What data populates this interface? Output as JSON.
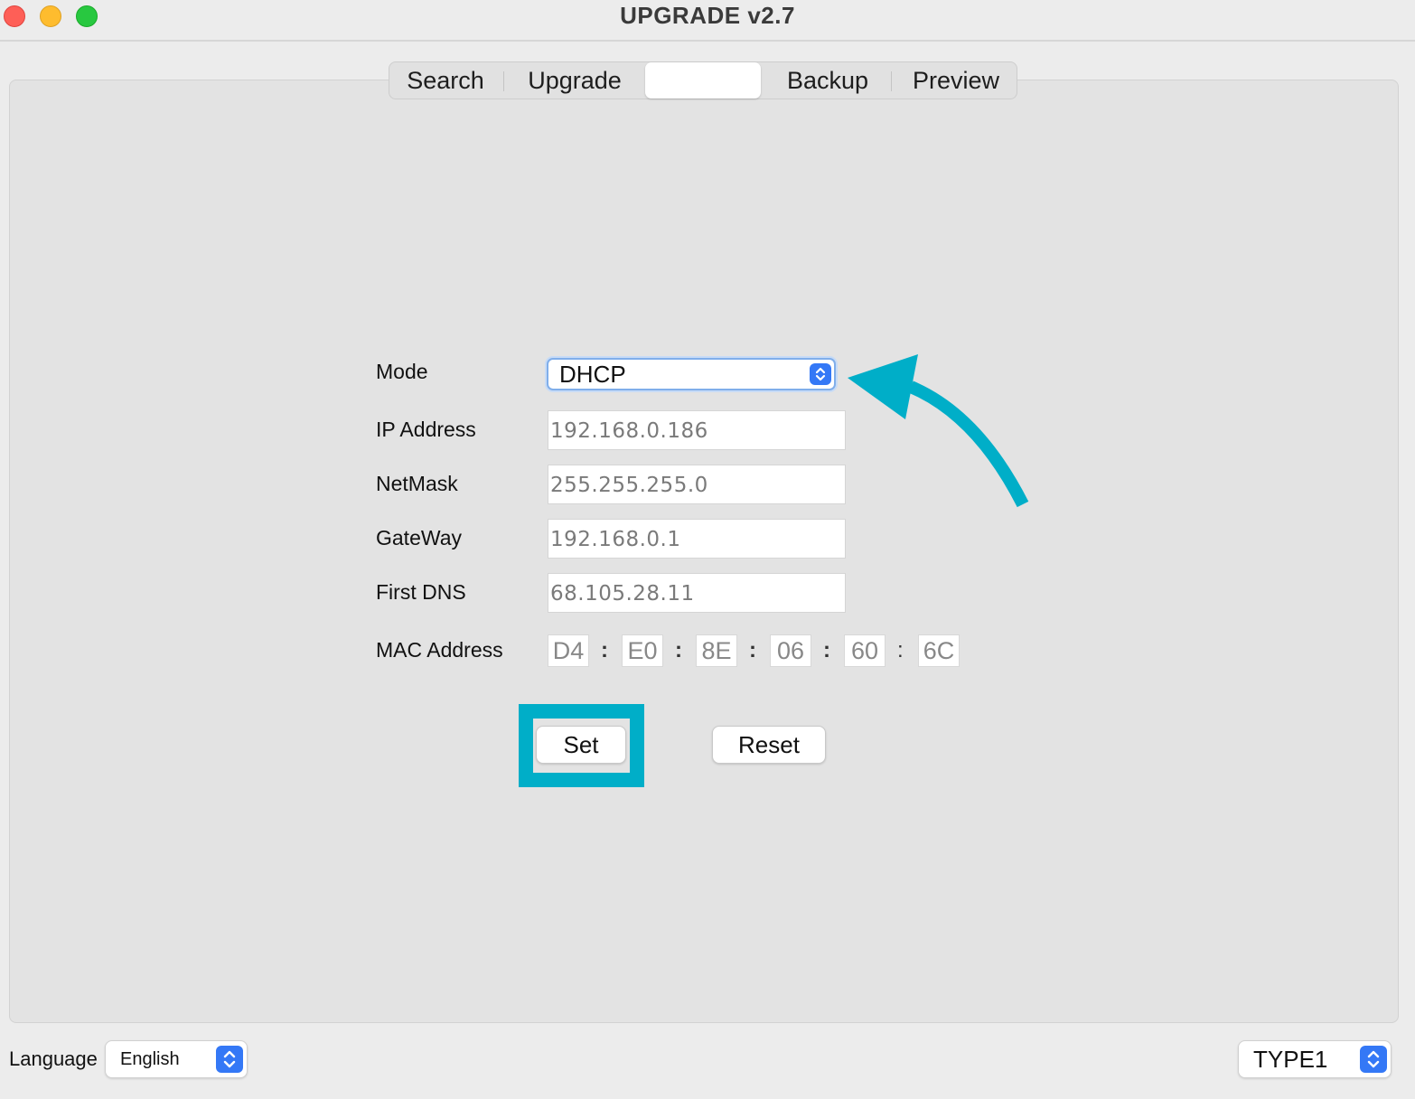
{
  "window": {
    "title": "UPGRADE v2.7"
  },
  "tabs": [
    {
      "label": "Search"
    },
    {
      "label": "Upgrade"
    },
    {
      "label": ""
    },
    {
      "label": "Backup"
    },
    {
      "label": "Preview"
    }
  ],
  "form": {
    "mode": {
      "label": "Mode",
      "value": "DHCP"
    },
    "ip": {
      "label": "IP Address",
      "value": "192.168.0.186"
    },
    "netmask": {
      "label": "NetMask",
      "value": "255.255.255.0"
    },
    "gateway": {
      "label": "GateWay",
      "value": "192.168.0.1"
    },
    "dns": {
      "label": "First DNS",
      "value": "68.105.28.11"
    },
    "mac": {
      "label": "MAC Address",
      "octets": [
        "D4",
        "E0",
        "8E",
        "06",
        "60",
        "6C"
      ],
      "separator": ":"
    }
  },
  "buttons": {
    "set": "Set",
    "reset": "Reset"
  },
  "footer": {
    "language_label": "Language",
    "language_value": "English",
    "type_value": "TYPE1"
  },
  "colors": {
    "annotation": "#00aec8",
    "accent": "#3478f6"
  }
}
